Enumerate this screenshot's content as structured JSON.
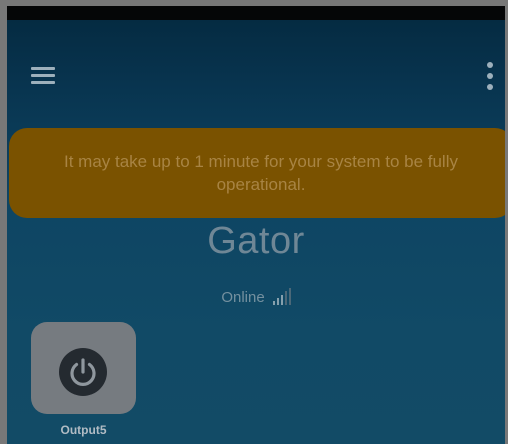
{
  "banner": {
    "message": "It may take up to 1 minute for your system to be fully operational."
  },
  "system": {
    "name": "Gator",
    "status": "Online",
    "signal_icon": "signal-strength-icon"
  },
  "outputs": [
    {
      "label": "Output5",
      "icon": "power-icon",
      "state": "off"
    }
  ],
  "icons": {
    "menu": "hamburger-menu-icon",
    "more": "more-vert-icon"
  },
  "colors": {
    "banner_bg": "#7a5200",
    "banner_text": "#a88443",
    "background_top": "#04293f",
    "background_bottom": "#124b66",
    "tile_bg": "#767b80"
  }
}
